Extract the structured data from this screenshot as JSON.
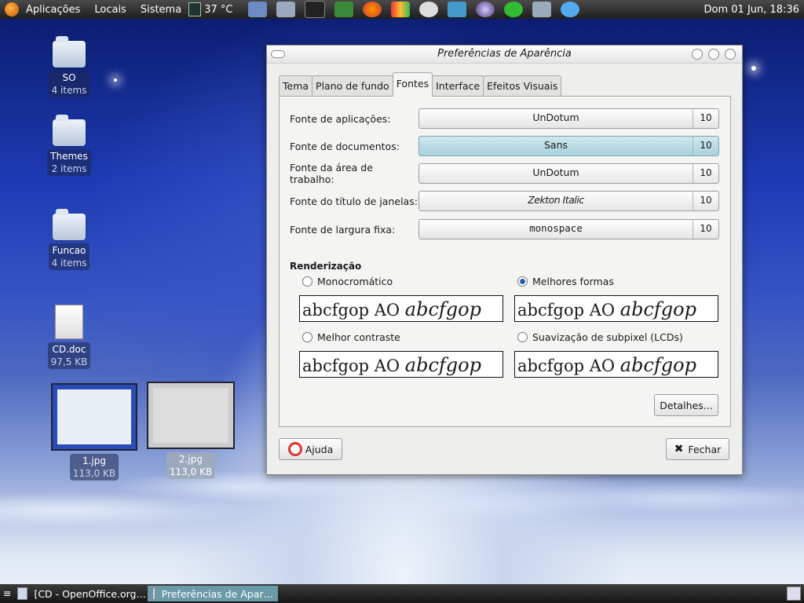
{
  "top_panel": {
    "menus": [
      "Aplicações",
      "Locais",
      "Sistema"
    ],
    "temperature": "37 °C",
    "clock": "Dom 01 Jun, 18:36",
    "icons": [
      "gnome-foot-icon",
      "temperature-icon",
      "folder-icon",
      "monitor-icon",
      "terminal-icon",
      "system-monitor-icon",
      "firefox-icon",
      "media-icon",
      "network-icon",
      "thunder-icon",
      "globe-icon",
      "play-icon",
      "screenshot-icon",
      "world-icon",
      "user-icon",
      "printer-icon"
    ]
  },
  "desktop": {
    "icons": [
      {
        "name": "SO",
        "sub": "4 items"
      },
      {
        "name": "Themes",
        "sub": "2 items"
      },
      {
        "name": "Funcao",
        "sub": "4 items"
      },
      {
        "name": "CD.doc",
        "sub": "97,5 KB"
      }
    ],
    "thumbnails": [
      {
        "name": "1.jpg",
        "sub": "113,0 KB"
      },
      {
        "name": "2.jpg",
        "sub": "113,0 KB"
      }
    ]
  },
  "window": {
    "title": "Preferências de Aparência",
    "tabs": [
      "Tema",
      "Plano de fundo",
      "Fontes",
      "Interface",
      "Efeitos Visuais"
    ],
    "active_tab": "Fontes",
    "fonts": [
      {
        "label": "Fonte de aplicações:",
        "font": "UnDotum",
        "size": "10"
      },
      {
        "label": "Fonte de documentos:",
        "font": "Sans",
        "size": "10"
      },
      {
        "label": "Fonte da área de trabalho:",
        "font": "UnDotum",
        "size": "10"
      },
      {
        "label": "Fonte do título de janelas:",
        "font": "Zekton Italic",
        "size": "10"
      },
      {
        "label": "Fonte de largura fixa:",
        "font": "monospace",
        "size": "10"
      }
    ],
    "rendering": {
      "heading": "Renderização",
      "options": [
        {
          "label": "Monocromático",
          "selected": false
        },
        {
          "label": "Melhores formas",
          "selected": true
        },
        {
          "label": "Melhor contraste",
          "selected": false
        },
        {
          "label": "Suavização de subpixel (LCDs)",
          "selected": false
        }
      ],
      "sample_text": "abcfgop AO",
      "sample_italic": "abcfgop"
    },
    "details_button": "Detalhes...",
    "help_button": "Ajuda",
    "close_button": "Fechar"
  },
  "bottom_panel": {
    "tasks": [
      {
        "label": "[CD - OpenOffice.org…"
      },
      {
        "label": "Preferências de Apar…"
      }
    ]
  }
}
